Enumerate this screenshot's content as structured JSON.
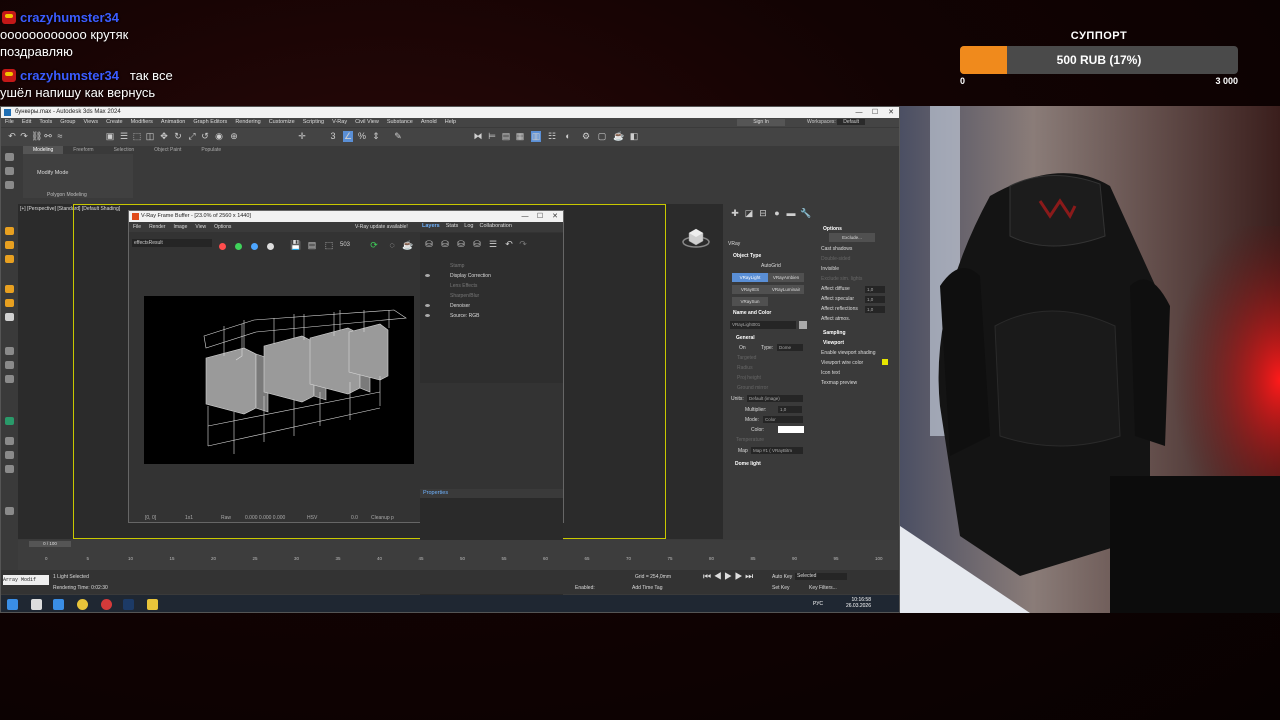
{
  "chat": {
    "messages": [
      {
        "user": "crazyhumster34",
        "text": "оооооооооооо крутяк"
      },
      {
        "user": "",
        "text": "поздравляю"
      },
      {
        "user": "crazyhumster34",
        "text": "так все"
      },
      {
        "user": "",
        "text": "ушёл напишу как вернусь"
      }
    ]
  },
  "donation_goal": {
    "title": "СУППОРТ",
    "label": "500 RUB (17%)",
    "progress_fraction": 0.17,
    "min": "0",
    "max": "3 000",
    "accent": "#f08a1c"
  },
  "max": {
    "window_title": "бункеры.max - Autodesk 3ds Max 2024",
    "menu": [
      "File",
      "Edit",
      "Tools",
      "Group",
      "Views",
      "Create",
      "Modifiers",
      "Animation",
      "Graph Editors",
      "Rendering",
      "Customize",
      "Scripting",
      "V-Ray",
      "Civil View",
      "Substance",
      "Arnold",
      "Help"
    ],
    "sign_in": "Sign In",
    "workspaces_label": "Workspaces:",
    "workspaces_value": "Default",
    "selection_set": "Create Selection Se",
    "path_field": "C:\\Users\\Ave...3ds Max 2024",
    "ribbon_tabs": [
      "Modeling",
      "Freeform",
      "Selection",
      "Object Paint",
      "Populate"
    ],
    "ribbon_mode": "Modify Mode",
    "ribbon_group": "Polygon Modeling",
    "viewport_label": "[+] [Perspective] [Standard] [Default Shading]",
    "timeline_pos": "0 / 100",
    "ticks": [
      "0",
      "5",
      "10",
      "15",
      "20",
      "25",
      "30",
      "35",
      "40",
      "45",
      "50",
      "55",
      "60",
      "65",
      "70",
      "75",
      "80",
      "85",
      "90",
      "95",
      "100"
    ],
    "status_left": "1 Light Selected",
    "status_render": "Rendering Time: 0:02:30",
    "status_array": "Array Modif",
    "grid": "Grid = 254,0mm",
    "enabled_label": "Enabled:",
    "add_time_tag": "Add Time Tag",
    "auto_key": "Auto Key",
    "selected_dd": "Selected",
    "set_key": "Set Key",
    "key_filters": "Key Filters...",
    "clock_time": "10:16:58",
    "clock_date": "26.03.2026",
    "lang": "РУС"
  },
  "vfb": {
    "title": "V-Ray Frame Buffer - [23.0% of 2560 x 1440]",
    "menu": [
      "File",
      "Render",
      "Image",
      "View",
      "Options"
    ],
    "update_notice": "V-Ray update available!",
    "tabs": [
      "Layers",
      "Stats",
      "Log",
      "Collaboration"
    ],
    "channel": "effectsResult",
    "layers": [
      {
        "name": "Stamp",
        "dim": true
      },
      {
        "name": "Display Correction",
        "dim": false
      },
      {
        "name": "Lens Effects",
        "dim": true
      },
      {
        "name": "Sharpen/Blur",
        "dim": true
      },
      {
        "name": "Denoiser",
        "dim": false
      },
      {
        "name": "Source: RGB",
        "dim": false
      }
    ],
    "properties": "Properties",
    "status_coords": "[0, 0]",
    "status_zoom": "1x1",
    "status_raw": "Raw",
    "status_vals": "0.000   0.000   0.000",
    "status_hsv": "HSV",
    "status_zero": "0.0",
    "status_cleanup": "Cleanup p"
  },
  "cmd": {
    "renderer": "VRay",
    "object_type": "Object Type",
    "autogrid": "AutoGrid",
    "buttons": [
      "VRayLight",
      "VRayAmbien",
      "VRayIES",
      "VRayLuminair",
      "VRaySun"
    ],
    "name_color": "Name and Color",
    "object_name": "VRayLight001",
    "general": "General",
    "on": "On",
    "type_label": "Type:",
    "type_value": "Dome",
    "targeted": "Targeted",
    "radius": "Radius",
    "proj_height": "Proj height",
    "ground_radius": "Ground mirror",
    "units_label": "Units:",
    "units_value": "Default (image)",
    "multiplier_label": "Multiplier:",
    "multiplier_value": "1,0",
    "mode_label": "Mode:",
    "mode_value": "Color",
    "color_label": "Color:",
    "temperature": "Temperature",
    "map_label": "Map",
    "map_value": "Map #1 ( VRayBitm",
    "dome_light": "Dome light",
    "options": "Options",
    "exclude": "Exclude...",
    "opts": [
      "Cast shadows",
      "Double-sided",
      "Invisible",
      "Exclude sim. lights",
      "Affect diffuse",
      "Affect specular",
      "Affect reflections",
      "Affect atmos."
    ],
    "opt_checked": [
      true,
      false,
      true,
      false,
      true,
      true,
      true,
      true
    ],
    "opt_values": [
      "1,0",
      "1,0",
      "1,0"
    ],
    "sampling": "Sampling",
    "viewport": "Viewport",
    "vp_opts": [
      "Enable viewport shading",
      "Viewport wire color",
      "Icon text",
      "Texmap preview"
    ]
  }
}
